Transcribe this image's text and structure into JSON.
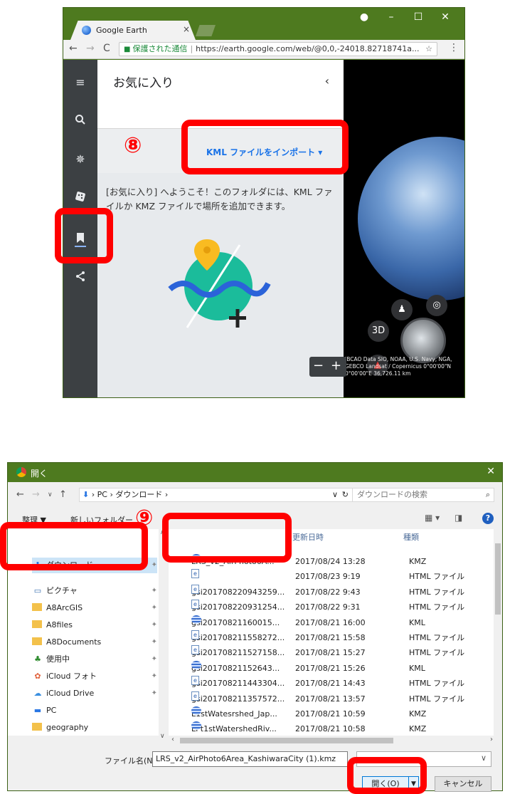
{
  "browser": {
    "tab_title": "Google Earth",
    "secure_label": "保護された通信",
    "url": "https://earth.google.com/web/@0,0,-24018.82718741a...",
    "panel_title": "お気に入り",
    "import_label": "KML ファイルをインポート",
    "welcome_text": "[お気に入り] へようこそ！このフォルダには、KML ファイルか KMZ ファイルで場所を追加できます。",
    "view_3d": "3D",
    "attribution": "IBCAO  Data SIO, NOAA, U.S. Navy, NGA, GEBCO  Landsat / Copernicus   0°00'00\"N 0°00'00\"E   36,726.11 km",
    "step_number": "⑧"
  },
  "dialog": {
    "title": "開く",
    "breadcrumb_pc": "PC",
    "breadcrumb_folder": "ダウンロード",
    "search_placeholder": "ダウンロードの検索",
    "organize_label": "整理 ▼",
    "new_folder_label": "新しいフォルダー",
    "step_number": "⑨",
    "col_date": "更新日時",
    "col_type": "種類",
    "nav_items": [
      {
        "label": "ダウンロード"
      },
      {
        "label": "ピクチャ"
      },
      {
        "label": "A8ArcGIS"
      },
      {
        "label": "A8files"
      },
      {
        "label": "A8Documents"
      },
      {
        "label": "使用中"
      },
      {
        "label": "iCloud フォト"
      },
      {
        "label": "iCloud Drive"
      },
      {
        "label": "PC"
      },
      {
        "label": "geography"
      }
    ],
    "files": [
      {
        "name": "LRS_v2_AirPhoto6A...",
        "date": "2017/08/24 13:28",
        "type": "KMZ",
        "icon": "kml"
      },
      {
        "name": "",
        "date": "2017/08/23 9:19",
        "type": "HTML ファイル",
        "icon": "html"
      },
      {
        "name": "gsi201708220943259...",
        "date": "2017/08/22 9:43",
        "type": "HTML ファイル",
        "icon": "html"
      },
      {
        "name": "gsi201708220931254...",
        "date": "2017/08/22 9:31",
        "type": "HTML ファイル",
        "icon": "html"
      },
      {
        "name": "gsi20170821160015...",
        "date": "2017/08/21 16:00",
        "type": "KML",
        "icon": "kml"
      },
      {
        "name": "gsi201708211558272...",
        "date": "2017/08/21 15:58",
        "type": "HTML ファイル",
        "icon": "html"
      },
      {
        "name": "gsi201708211527158...",
        "date": "2017/08/21 15:27",
        "type": "HTML ファイル",
        "icon": "html"
      },
      {
        "name": "gsi20170821152643...",
        "date": "2017/08/21 15:26",
        "type": "KML",
        "icon": "kml"
      },
      {
        "name": "gsi201708211443304...",
        "date": "2017/08/21 14:43",
        "type": "HTML ファイル",
        "icon": "html"
      },
      {
        "name": "gsi201708211357572...",
        "date": "2017/08/21 13:57",
        "type": "HTML ファイル",
        "icon": "html"
      },
      {
        "name": "L1stWatesrshed_Jap...",
        "date": "2017/08/21 10:59",
        "type": "KMZ",
        "icon": "kml"
      },
      {
        "name": "LPt1stWatershedRiv...",
        "date": "2017/08/21 10:58",
        "type": "KMZ",
        "icon": "kml"
      }
    ],
    "filename_label": "ファイル名(N):",
    "filename_value": "LRS_v2_AirPhoto6Area_KashiwaraCity (1).kmz",
    "open_label": "開く(O)",
    "cancel_label": "キャンセル"
  },
  "colors": {
    "titlebar": "#4e7a1f",
    "callout": "#ff0000",
    "link_blue": "#1a73e8"
  }
}
